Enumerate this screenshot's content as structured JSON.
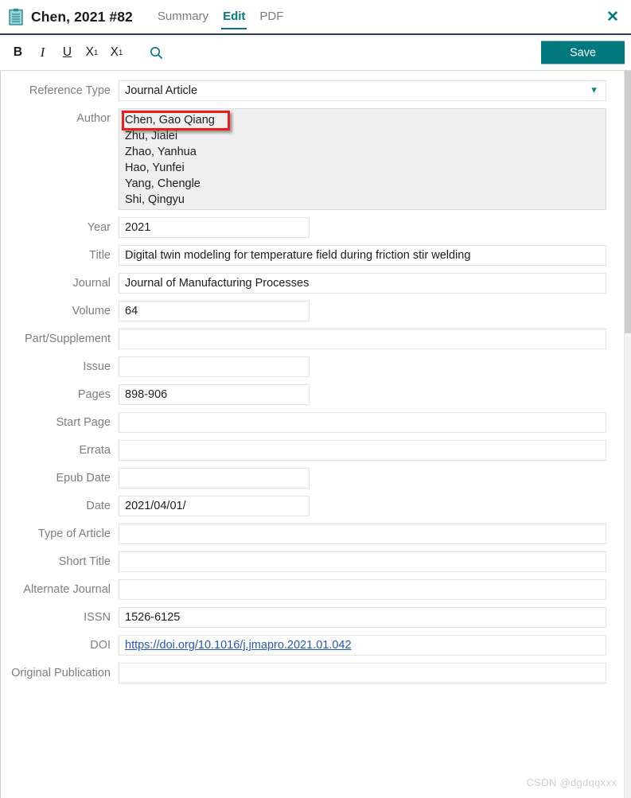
{
  "header": {
    "icon": "clipboard-icon",
    "record_title": "Chen, 2021 #82",
    "tabs": [
      {
        "label": "Summary",
        "active": false
      },
      {
        "label": "Edit",
        "active": true
      },
      {
        "label": "PDF",
        "active": false
      }
    ],
    "close_label": "✕"
  },
  "toolbar": {
    "bold_label": "B",
    "italic_label": "I",
    "underline_label": "U",
    "superscript_base": "X",
    "superscript_exp": "1",
    "subscript_base": "X",
    "subscript_exp": "1",
    "search_icon": "search-icon",
    "save_label": "Save",
    "save_color": "#00787e"
  },
  "accent_color": "#00797f",
  "link_color": "#2158b5",
  "highlight_color": "#ee1b18",
  "form": {
    "reference_type": {
      "label": "Reference Type",
      "value": "Journal Article",
      "chevron": "chevron-down-icon"
    },
    "author": {
      "label": "Author",
      "values": [
        "Chen, Gao Qiang",
        "Zhu, Jialei",
        "Zhao, Yanhua",
        "Hao, Yunfei",
        "Yang, Chengle",
        "Shi, Qingyu"
      ],
      "highlighted_index": 0
    },
    "fields": [
      {
        "label": "Year",
        "value": "2021",
        "width": "short",
        "type": "text"
      },
      {
        "label": "Title",
        "value": "Digital twin modeling for temperature field during friction stir welding",
        "width": "wide",
        "type": "text"
      },
      {
        "label": "Journal",
        "value": "Journal of Manufacturing Processes",
        "width": "wide",
        "type": "text"
      },
      {
        "label": "Volume",
        "value": "64",
        "width": "short",
        "type": "text"
      },
      {
        "label": "Part/Supplement",
        "value": "",
        "width": "wide",
        "type": "text"
      },
      {
        "label": "Issue",
        "value": "",
        "width": "short",
        "type": "text"
      },
      {
        "label": "Pages",
        "value": "898-906",
        "width": "short",
        "type": "text"
      },
      {
        "label": "Start Page",
        "value": "",
        "width": "wide",
        "type": "text"
      },
      {
        "label": "Errata",
        "value": "",
        "width": "wide",
        "type": "text"
      },
      {
        "label": "Epub Date",
        "value": "",
        "width": "short",
        "type": "text"
      },
      {
        "label": "Date",
        "value": "2021/04/01/",
        "width": "short",
        "type": "text"
      },
      {
        "label": "Type of Article",
        "value": "",
        "width": "wide",
        "type": "text"
      },
      {
        "label": "Short Title",
        "value": "",
        "width": "wide",
        "type": "text"
      },
      {
        "label": "Alternate Journal",
        "value": "",
        "width": "wide",
        "type": "text"
      },
      {
        "label": "ISSN",
        "value": "1526-6125",
        "width": "wide",
        "type": "text"
      },
      {
        "label": "DOI",
        "value": "https://doi.org/10.1016/j.jmapro.2021.01.042",
        "width": "wide",
        "type": "link"
      },
      {
        "label": "Original Publication",
        "value": "",
        "width": "wide",
        "type": "text"
      }
    ]
  },
  "watermark": "CSDN @dgdqqxxx"
}
